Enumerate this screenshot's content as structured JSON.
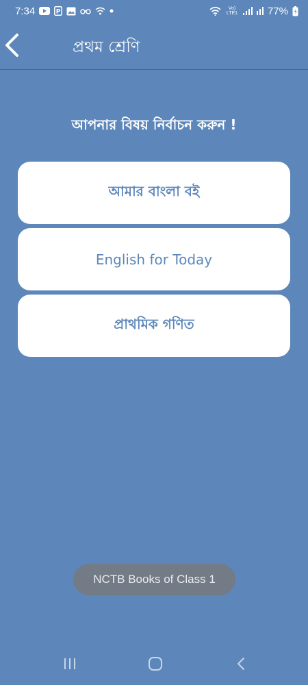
{
  "status_bar": {
    "time": "7:34",
    "network_label": "Vo) LTE1",
    "battery": "77%"
  },
  "app_bar": {
    "title": "প্রথম শ্রেণি"
  },
  "prompt": "আপনার বিষয় নির্বাচন করুন !",
  "subjects": [
    {
      "label": "আমার বাংলা বই"
    },
    {
      "label": "English for Today"
    },
    {
      "label": "প্রাথমিক গণিত"
    }
  ],
  "toast": "NCTB Books of Class 1",
  "colors": {
    "background": "#5d87ba",
    "card": "#ffffff",
    "card_text": "#5d87ba",
    "toast_bg": "#737b86"
  }
}
